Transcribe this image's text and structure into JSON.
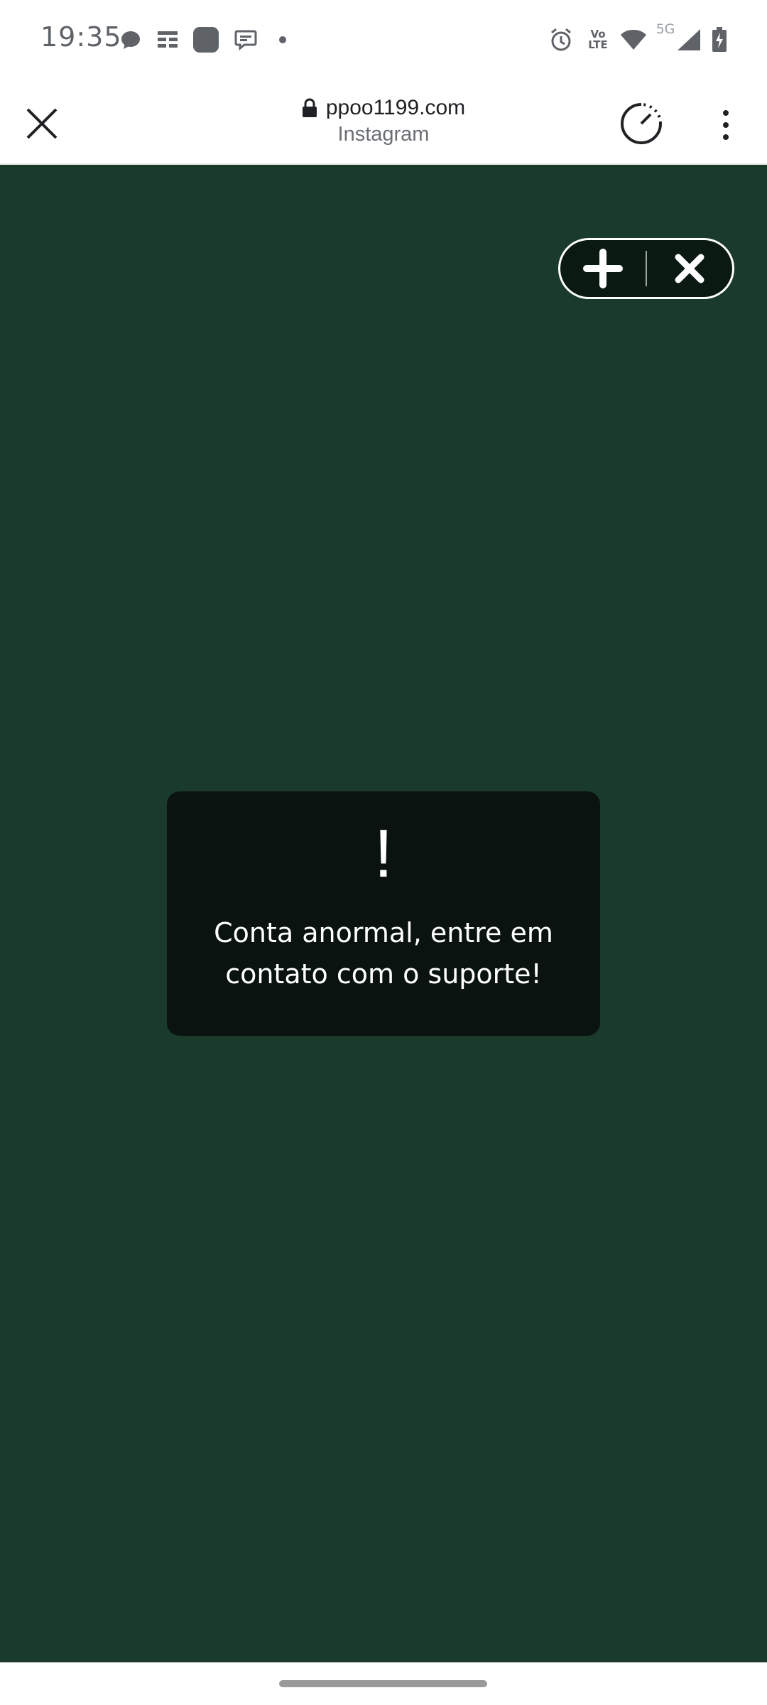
{
  "status_bar": {
    "time": "19:35",
    "icons_left": [
      "chat-bubble-icon",
      "notification-list-icon",
      "app-square-icon",
      "message-icon",
      "dot-icon"
    ],
    "icons_right": [
      "alarm-icon",
      "volte-icon",
      "wifi-icon",
      "signal-5g-icon",
      "battery-charging-icon"
    ],
    "network_label": "5G",
    "volte_label_top": "Vo",
    "volte_label_bottom": "LTE"
  },
  "toolbar": {
    "domain": "ppoo1199.com",
    "site_name": "Instagram"
  },
  "page": {
    "background_color": "#1a3a2b",
    "dialog": {
      "mark": "!",
      "message": "Conta anormal, entre em contato com o suporte!"
    }
  }
}
